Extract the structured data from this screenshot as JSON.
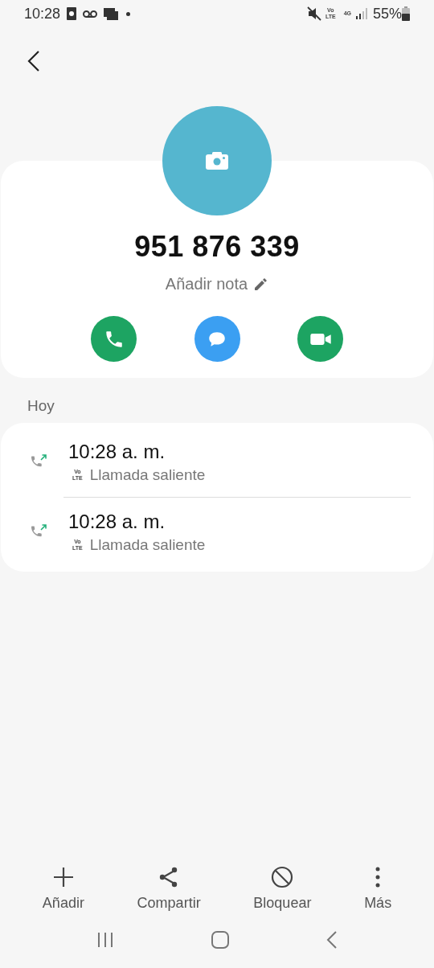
{
  "status_bar": {
    "time": "10:28",
    "network_badge": [
      "Vo",
      "LTE"
    ],
    "network_type": "4G",
    "battery": "55%"
  },
  "contact": {
    "number": "951 876 339",
    "note_placeholder": "Añadir nota"
  },
  "actions": [
    {
      "kind": "call",
      "color": "#1da462"
    },
    {
      "kind": "message",
      "color": "#3b9ff2"
    },
    {
      "kind": "video",
      "color": "#1da462"
    }
  ],
  "history": {
    "heading": "Hoy",
    "calls": [
      {
        "time": "10:28 a. m.",
        "badge": [
          "Vo",
          "LTE"
        ],
        "type": "Llamada saliente"
      },
      {
        "time": "10:28 a. m.",
        "badge": [
          "Vo",
          "LTE"
        ],
        "type": "Llamada saliente"
      }
    ]
  },
  "bottom_actions": [
    {
      "kind": "add",
      "label": "Añadir"
    },
    {
      "kind": "share",
      "label": "Compartir"
    },
    {
      "kind": "block",
      "label": "Bloquear"
    },
    {
      "kind": "more",
      "label": "Más"
    }
  ]
}
